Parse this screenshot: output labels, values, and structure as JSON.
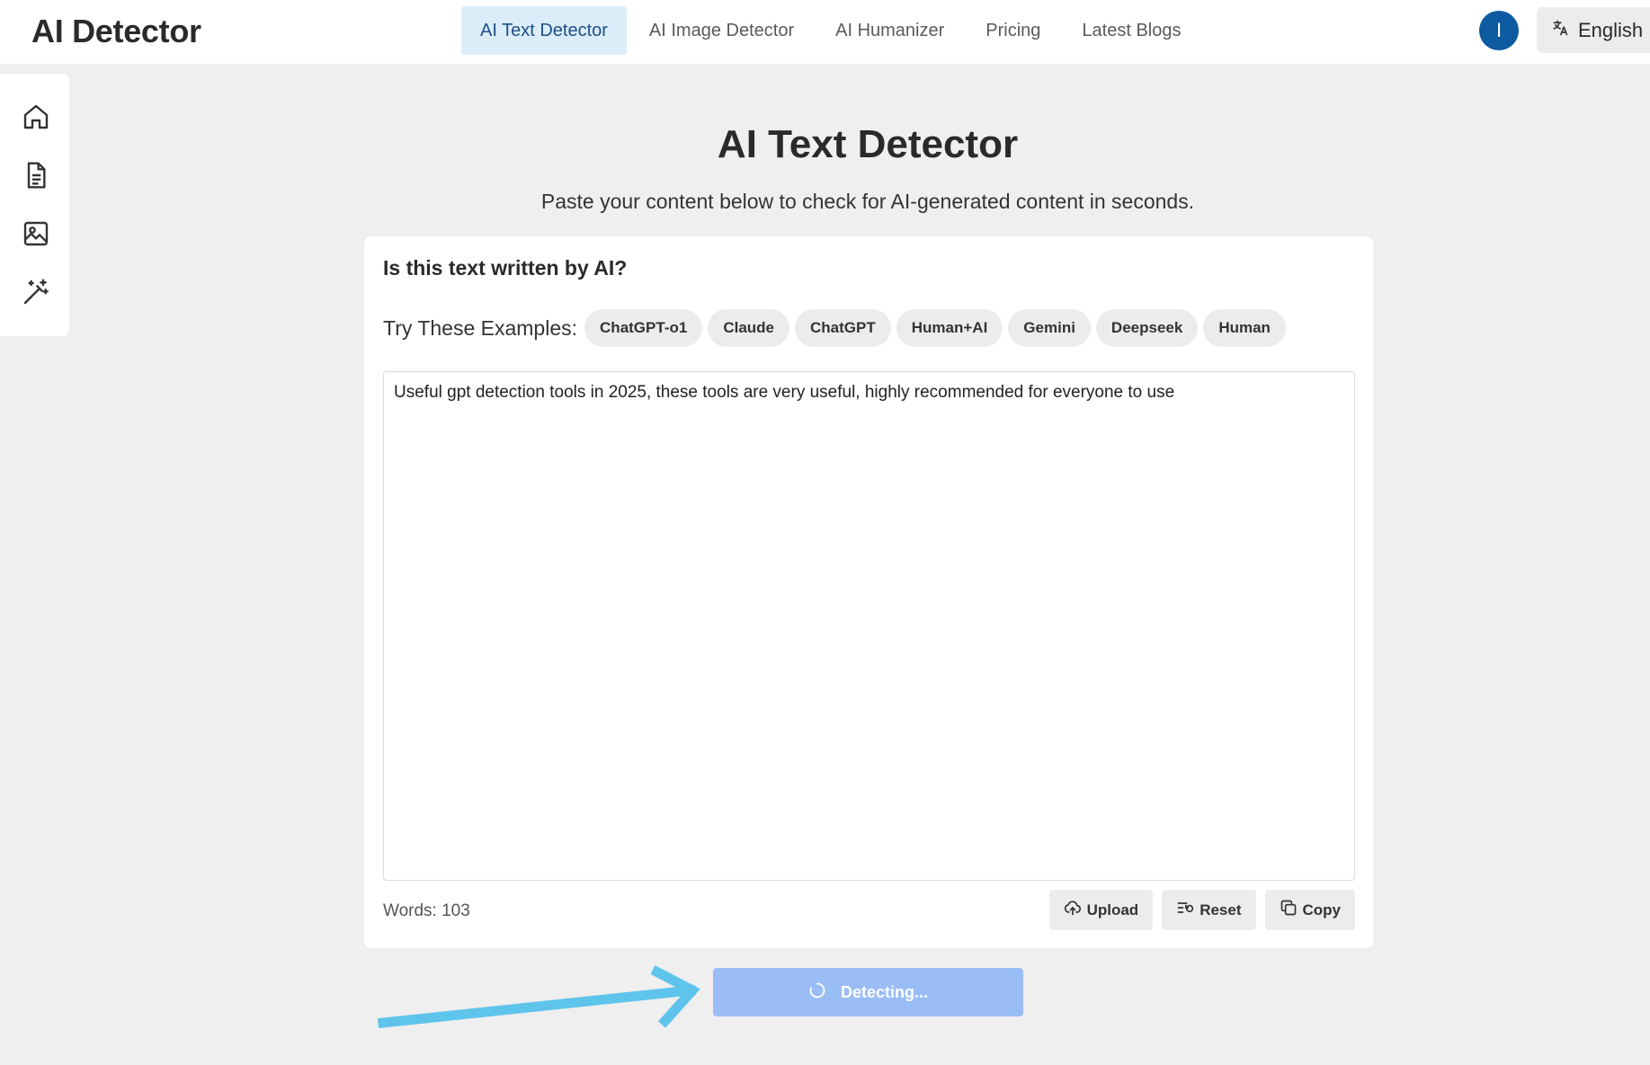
{
  "header": {
    "logo": "AI Detector",
    "nav": [
      {
        "label": "AI Text Detector",
        "active": true
      },
      {
        "label": "AI Image Detector",
        "active": false
      },
      {
        "label": "AI Humanizer",
        "active": false
      },
      {
        "label": "Pricing",
        "active": false
      },
      {
        "label": "Latest Blogs",
        "active": false
      }
    ],
    "avatar_initial": "I",
    "language": "English",
    "language_icon": "translate-icon"
  },
  "sidebar": {
    "icons": [
      "home-icon",
      "document-icon",
      "image-icon",
      "magic-wand-icon"
    ]
  },
  "main": {
    "title": "AI Text Detector",
    "subtitle": "Paste your content below to check for AI-generated content in seconds.",
    "card": {
      "question": "Is this text written by AI?",
      "examples_label": "Try These Examples:",
      "examples": [
        "ChatGPT-o1",
        "Claude",
        "ChatGPT",
        "Human+AI",
        "Gemini",
        "Deepseek",
        "Human"
      ],
      "text": "Useful gpt detection tools in 2025, these tools are very useful, highly recommended for everyone to use",
      "words": "Words: 103",
      "actions": {
        "upload": "Upload",
        "reset": "Reset",
        "copy": "Copy"
      }
    },
    "detect_label": "Detecting..."
  },
  "colors": {
    "active_nav_bg": "#dcedfa",
    "active_nav_text": "#1d4f86",
    "avatar_bg": "#0d5aa1",
    "detect_button": "#9bbdf5",
    "annotation_arrow": "#5ec4ec"
  }
}
